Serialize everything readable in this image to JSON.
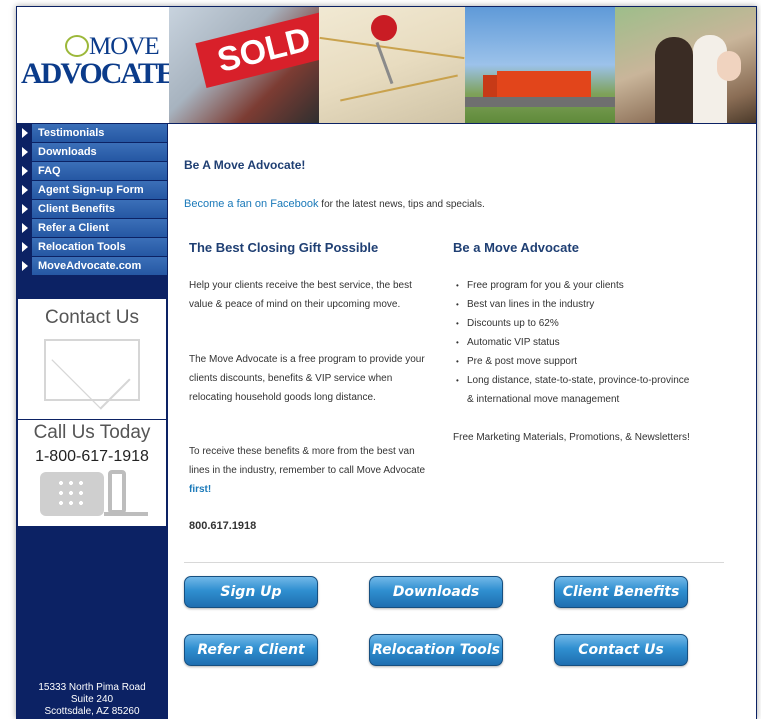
{
  "logo": {
    "line1": "MOVE",
    "line2": "ADVOCATE"
  },
  "header_photos": {
    "sold_sign": "SOLD"
  },
  "sidebar": {
    "nav": [
      {
        "label": "Testimonials"
      },
      {
        "label": "Downloads"
      },
      {
        "label": "FAQ"
      },
      {
        "label": "Agent Sign-up Form"
      },
      {
        "label": "Client Benefits"
      },
      {
        "label": "Refer a Client"
      },
      {
        "label": "Relocation Tools"
      },
      {
        "label": "MoveAdvocate.com"
      }
    ],
    "contact_title": "Contact Us",
    "call_title": "Call Us Today",
    "call_phone": "1-800-617-1918",
    "address": [
      "15333 North Pima Road",
      "Suite 240",
      "Scottsdale, AZ 85260"
    ]
  },
  "main": {
    "heading": "Be A Move Advocate!",
    "fan_link": "Become a fan on Facebook",
    "fan_rest": " for the latest news, tips and specials.",
    "left_col": {
      "title": "The Best Closing Gift Possible",
      "para1": "Help your clients receive the best service, the best value & peace of mind on their upcoming move.",
      "para2": "The Move Advocate is a free program to provide your clients discounts, benefits & VIP service when relocating household goods long distance.",
      "para3_text": "To receive these benefits & more from the best van lines in the industry, remember to call Move Advocate ",
      "para3_em": "first!",
      "phone": "800.617.1918"
    },
    "right_col": {
      "title": "Be a Move Advocate",
      "bullets": [
        "Free program for you & your clients",
        "Best van lines in the industry",
        "Discounts up to 62%",
        "Automatic VIP status",
        "Pre & post move support",
        "Long distance, state-to-state, province-to-province & international move management"
      ],
      "free_materials": "Free Marketing Materials, Promotions, & Newsletters!"
    },
    "buttons": [
      "Sign Up",
      "Downloads",
      "Client Benefits",
      "Refer a Client",
      "Relocation Tools",
      "Contact Us"
    ]
  },
  "colors": {
    "navy": "#0c2264",
    "nav_blue": "#2557a3",
    "heading_blue": "#1f3f73",
    "link_blue": "#1a79b9",
    "button_blue": "#2f8fd0"
  }
}
